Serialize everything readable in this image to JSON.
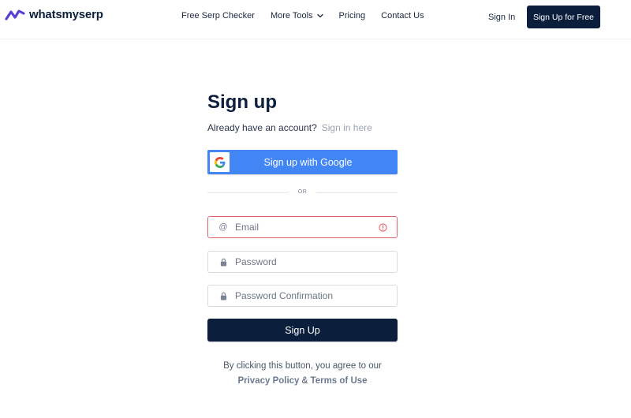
{
  "header": {
    "logo_text": "whatsmyserp",
    "nav": {
      "free_serp_checker": "Free Serp Checker",
      "more_tools": "More Tools",
      "pricing": "Pricing",
      "contact_us": "Contact Us"
    },
    "sign_in": "Sign In",
    "sign_up_free": "Sign Up for Free"
  },
  "form": {
    "title": "Sign up",
    "already_text": "Already have an account?",
    "sign_in_link": "Sign in here",
    "google_button": "Sign up with Google",
    "or_text": "OR",
    "email_placeholder": "Email",
    "email_value": "",
    "email_has_error": true,
    "password_placeholder": "Password",
    "password_value": "",
    "password_confirm_placeholder": "Password Confirmation",
    "password_confirm_value": "",
    "submit": "Sign Up",
    "terms_prefix": "By clicking this button, you agree to our",
    "privacy_link": "Privacy Policy",
    "terms_amp": "&",
    "terms_link": "Terms of Use"
  },
  "icons": {
    "logo": "whatsmyserp-logo-icon",
    "chevron": "chevron-down-icon",
    "google": "google-g-icon",
    "email": "at-sign-icon",
    "lock": "lock-icon",
    "error": "alert-circle-icon"
  },
  "colors": {
    "brand_navy": "#0b1f3d",
    "google_blue": "#4285f4",
    "error_red": "#e36363",
    "logo_purple": "#5a3fd4"
  }
}
